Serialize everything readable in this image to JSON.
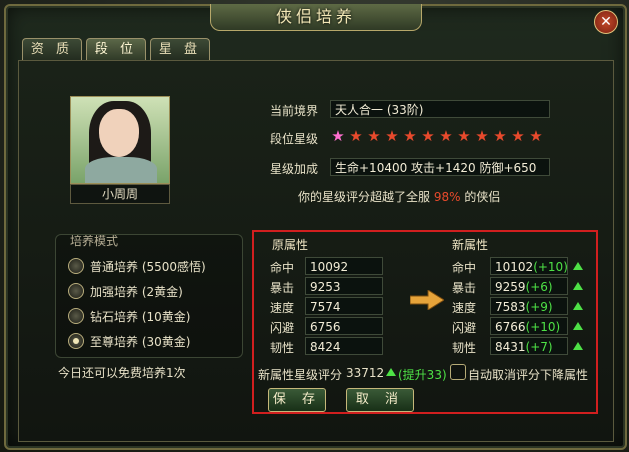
{
  "window": {
    "title": "侠侣培养",
    "close_icon": "close-icon"
  },
  "tabs": [
    {
      "label": "资 质"
    },
    {
      "label": "段 位"
    },
    {
      "label": "星 盘"
    }
  ],
  "character": {
    "name": "小周周",
    "realm_label": "当前境界",
    "realm_value": "天人合一 (33阶)",
    "star_label": "段位星级",
    "star_bonus_label": "星级加成",
    "star_bonus_value": "生命+10400 攻击+1420 防御+650",
    "rating_prefix": "你的星级评分超越了全服",
    "rating_percent": "98%",
    "rating_suffix": "的侠侣"
  },
  "training": {
    "title": "培养模式",
    "options": [
      {
        "label": "普通培养 (5500感悟)"
      },
      {
        "label": "加强培养 (2黄金)"
      },
      {
        "label": "钻石培养 (10黄金)"
      },
      {
        "label": "至尊培养 (30黄金)"
      }
    ],
    "free_text": "今日还可以免费培养1次"
  },
  "attributes": {
    "old_title": "原属性",
    "new_title": "新属性",
    "rows": [
      {
        "name": "命中",
        "old": "10092",
        "new": "10102",
        "diff": "(+10)"
      },
      {
        "name": "暴击",
        "old": "9253",
        "new": "9259",
        "diff": "(+6)"
      },
      {
        "name": "速度",
        "old": "7574",
        "new": "7583",
        "diff": "(+9)"
      },
      {
        "name": "闪避",
        "old": "6756",
        "new": "6766",
        "diff": "(+10)"
      },
      {
        "name": "韧性",
        "old": "8424",
        "new": "8431",
        "diff": "(+7)"
      }
    ],
    "new_score_label": "新属性星级评分",
    "new_score_value": "33712",
    "new_score_boost": "(提升33)",
    "auto_cancel_label": "自动取消评分下降属性"
  },
  "buttons": {
    "save": "保 存",
    "cancel": "取 消"
  }
}
